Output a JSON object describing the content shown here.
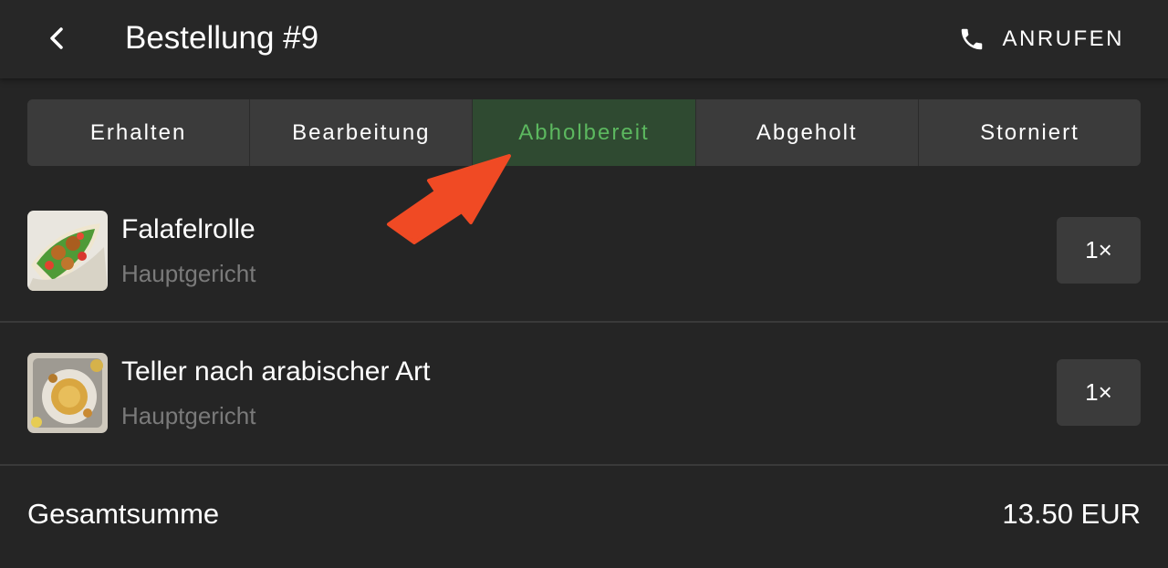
{
  "header": {
    "title": "Bestellung #9",
    "call_label": "ANRUFEN",
    "back_icon": "chevron-left-icon",
    "call_icon": "phone-icon"
  },
  "tabs": [
    {
      "label": "Erhalten",
      "active": false
    },
    {
      "label": "Bearbeitung",
      "active": false
    },
    {
      "label": "Abholbereit",
      "active": true
    },
    {
      "label": "Abgeholt",
      "active": false
    },
    {
      "label": "Storniert",
      "active": false
    }
  ],
  "items": [
    {
      "name": "Falafelrolle",
      "category": "Hauptgericht",
      "quantity": "1×"
    },
    {
      "name": "Teller nach arabischer Art",
      "category": "Hauptgericht",
      "quantity": "1×"
    }
  ],
  "total": {
    "label": "Gesamtsumme",
    "value": "13.50 EUR"
  },
  "colors": {
    "background": "#252525",
    "active_tab_bg": "#2f4a31",
    "active_tab_text": "#5cb85f",
    "arrow": "#f04a24",
    "secondary_text": "#7a7a7a"
  }
}
